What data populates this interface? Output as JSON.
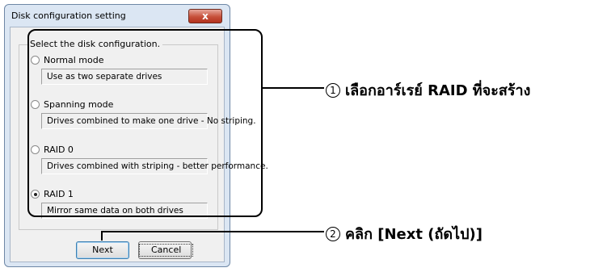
{
  "dialog": {
    "title": "Disk configuration setting",
    "close_label": "x",
    "group_label": "Select the disk configuration.",
    "options": [
      {
        "label": "Normal mode",
        "description": "Use as two separate drives",
        "selected": false
      },
      {
        "label": "Spanning mode",
        "description": "Drives combined to make one drive - No striping.",
        "selected": false
      },
      {
        "label": "RAID 0",
        "description": "Drives combined with striping - better performance.",
        "selected": false
      },
      {
        "label": "RAID 1",
        "description": "Mirror same data on both drives",
        "selected": true
      }
    ],
    "next_label": "Next",
    "cancel_label": "Cancel"
  },
  "annotations": {
    "step1_number": "1",
    "step1_text": "เลือกอาร์เรย์ RAID ที่จะสร้าง",
    "step2_number": "2",
    "step2_text": "คลิก [Next (ถัดไป)]"
  }
}
